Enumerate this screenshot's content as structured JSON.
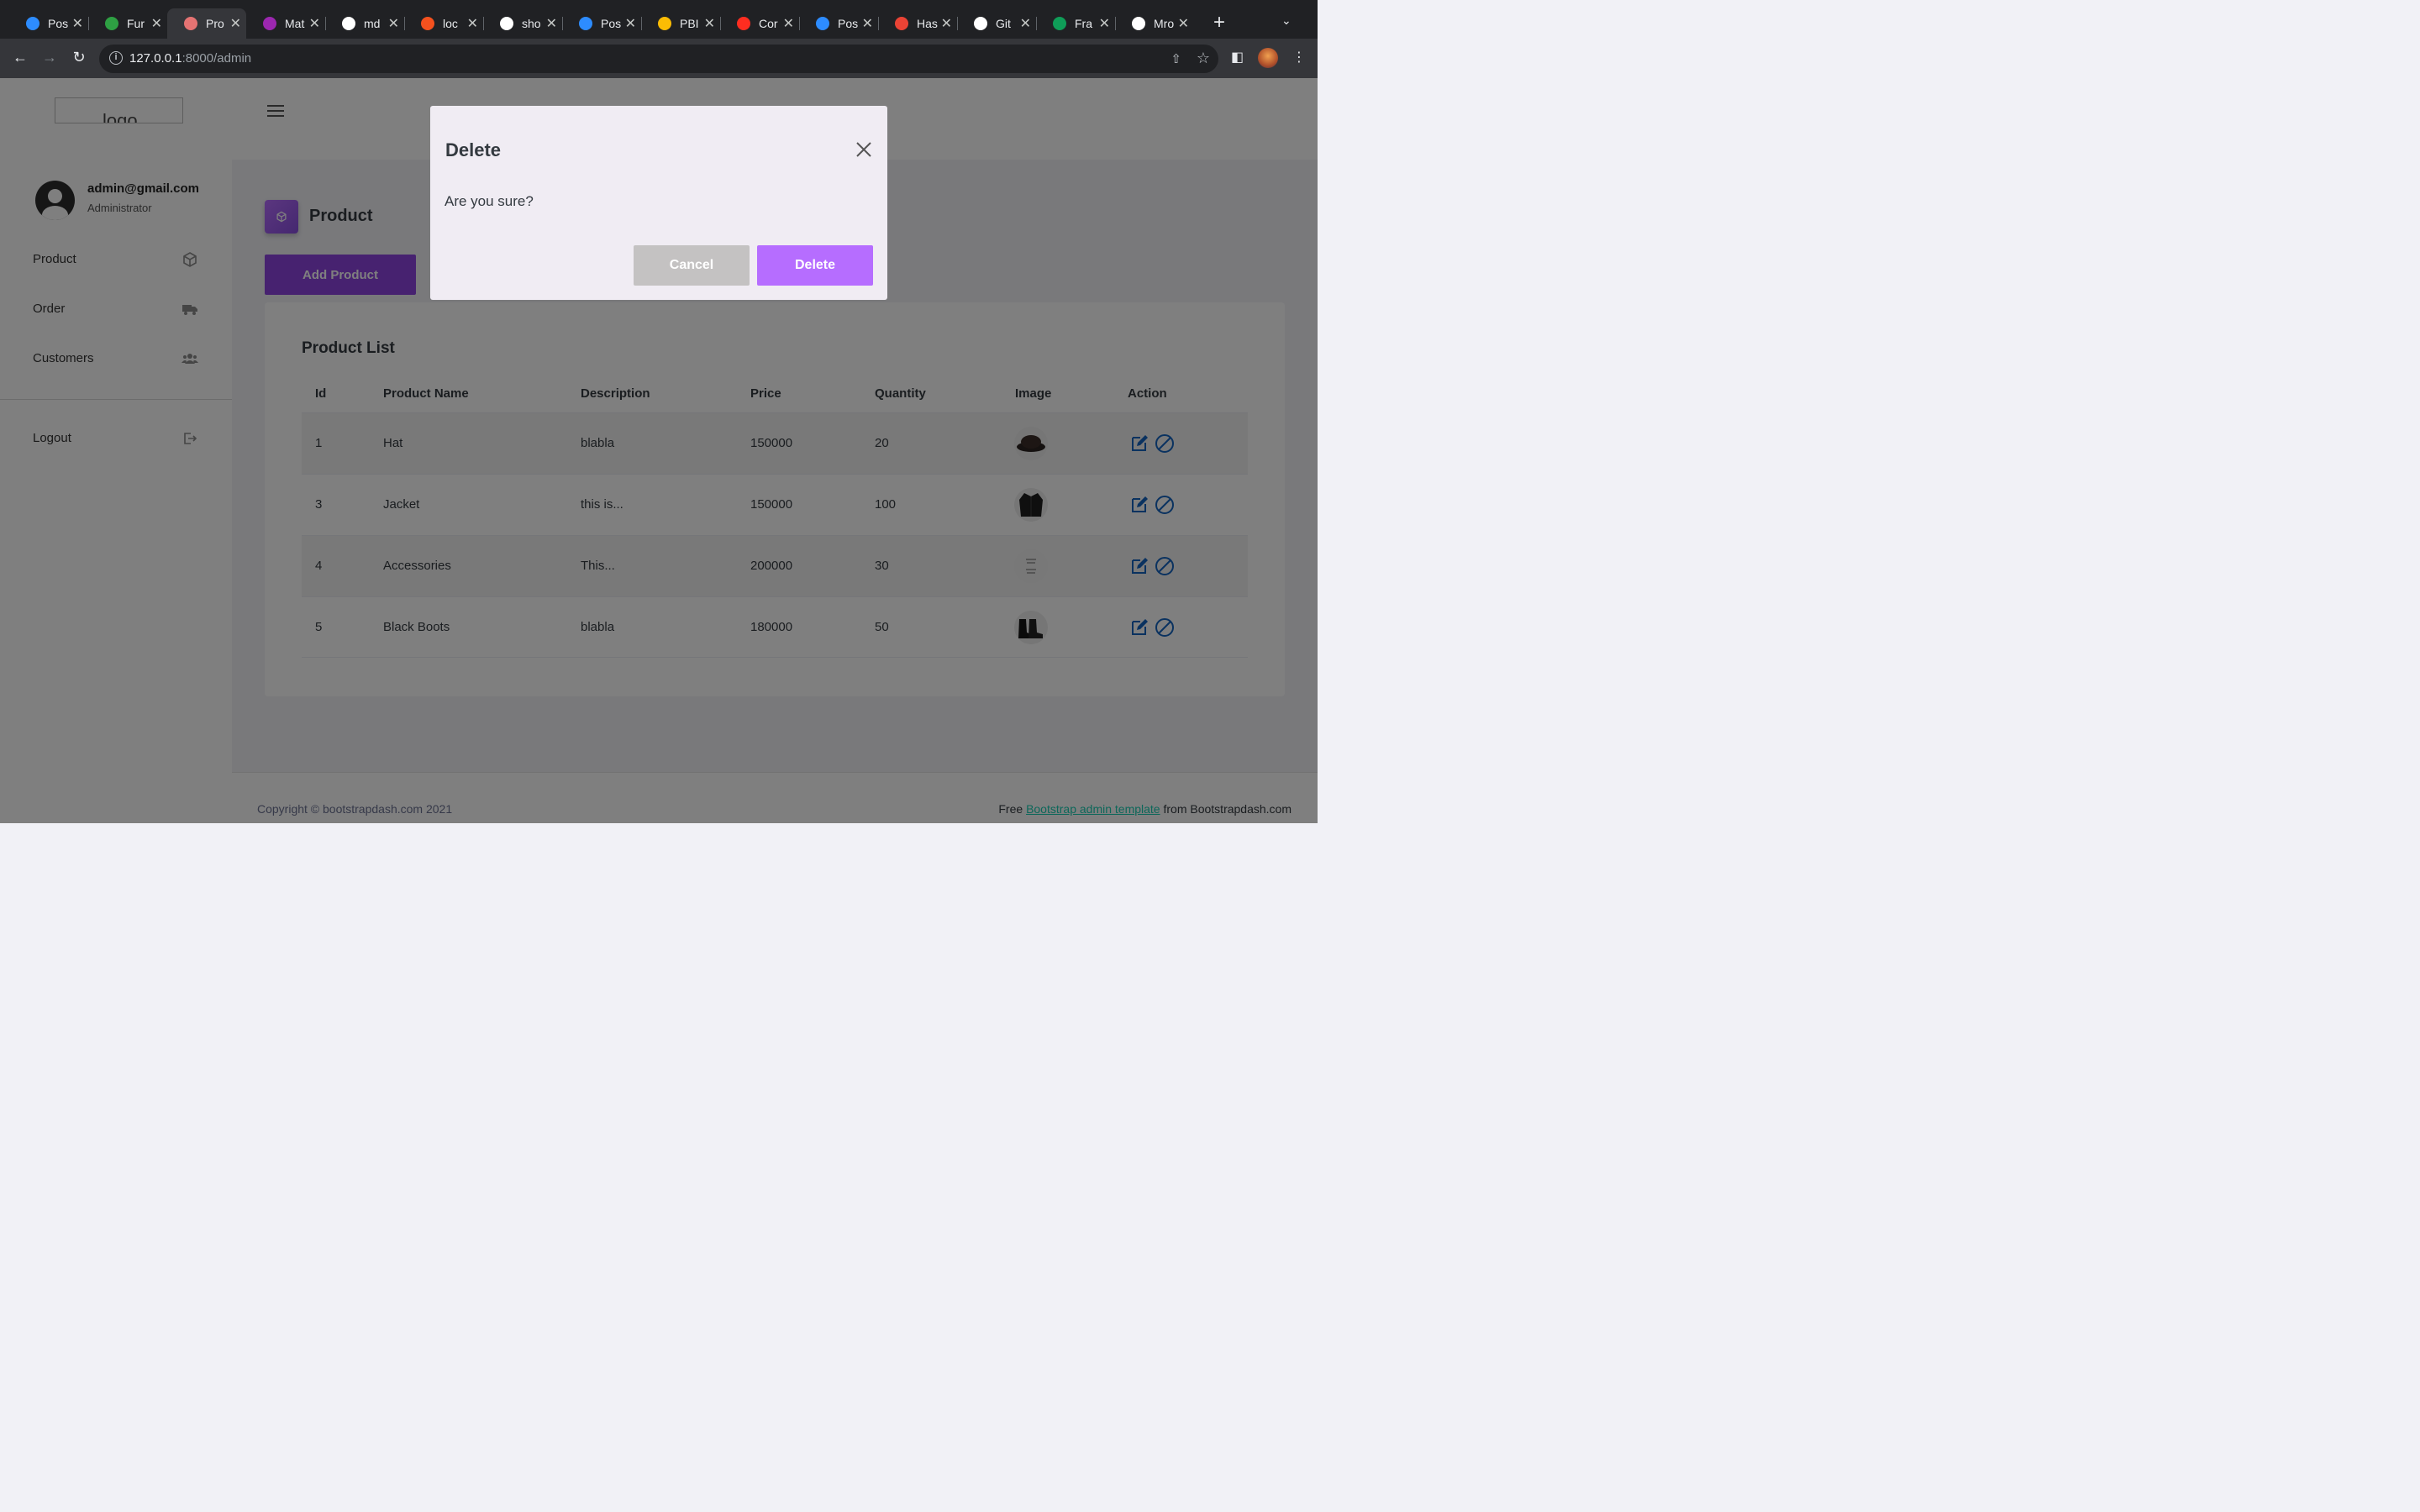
{
  "browser": {
    "tabs": [
      {
        "title": "Pos",
        "icon": "zoom-icon",
        "color": "#2d8cff"
      },
      {
        "title": "Fur",
        "icon": "leaf-icon",
        "color": "#2ea043"
      },
      {
        "title": "Pro",
        "icon": "app-grid-icon",
        "color": "#e57373"
      },
      {
        "title": "Mat",
        "icon": "p-icon",
        "color": "#9c27b0"
      },
      {
        "title": "md",
        "icon": "google-icon",
        "color": "#ffffff"
      },
      {
        "title": "loc",
        "icon": "laravel-logo-icon",
        "color": "#f4511e"
      },
      {
        "title": "sho",
        "icon": "google-icon",
        "color": "#ffffff"
      },
      {
        "title": "Pos",
        "icon": "zoom-icon",
        "color": "#2d8cff"
      },
      {
        "title": "PBI",
        "icon": "drive-icon",
        "color": "#fbbc04"
      },
      {
        "title": "Cor",
        "icon": "laravel-icon",
        "color": "#ff2d20"
      },
      {
        "title": "Pos",
        "icon": "zoom-icon",
        "color": "#2d8cff"
      },
      {
        "title": "Has",
        "icon": "gmail-icon",
        "color": "#ea4335"
      },
      {
        "title": "Git",
        "icon": "github-icon",
        "color": "#ffffff"
      },
      {
        "title": "Fra",
        "icon": "sheets-icon",
        "color": "#0f9d58"
      },
      {
        "title": "Mro",
        "icon": "github-icon",
        "color": "#ffffff"
      }
    ],
    "active_tab_index": 2,
    "url_host": "127.0.0.1",
    "url_rest": ":8000/admin"
  },
  "sidebar": {
    "logo_alt": "logo",
    "user_email": "admin@gmail.com",
    "user_role": "Administrator",
    "items": [
      {
        "label": "Product",
        "icon": "cube-icon"
      },
      {
        "label": "Order",
        "icon": "truck-icon"
      },
      {
        "label": "Customers",
        "icon": "users-icon"
      }
    ],
    "logout_label": "Logout"
  },
  "main": {
    "page_title": "Product",
    "add_button_label": "Add Product",
    "card_title": "Product List",
    "columns": [
      "Id",
      "Product Name",
      "Description",
      "Price",
      "Quantity",
      "Image",
      "Action"
    ],
    "rows": [
      {
        "id": "1",
        "name": "Hat",
        "description": "blabla",
        "price": "150000",
        "quantity": "20",
        "image": "hat"
      },
      {
        "id": "3",
        "name": "Jacket",
        "description": "this is...",
        "price": "150000",
        "quantity": "100",
        "image": "jacket"
      },
      {
        "id": "4",
        "name": "Accessories",
        "description": "This...",
        "price": "200000",
        "quantity": "30",
        "image": "accessories"
      },
      {
        "id": "5",
        "name": "Black Boots",
        "description": "blabla",
        "price": "180000",
        "quantity": "50",
        "image": "boots"
      }
    ]
  },
  "footer": {
    "copyright": "Copyright © bootstrapdash.com 2021",
    "free_prefix": "Free ",
    "link_text": "Bootstrap admin template",
    "suffix": " from Bootstrapdash.com"
  },
  "modal": {
    "title": "Delete",
    "body": "Are you sure?",
    "cancel_label": "Cancel",
    "delete_label": "Delete"
  },
  "colors": {
    "accent": "#b66dff",
    "link": "#1bcfb4",
    "action_icon": "#1565c0"
  }
}
